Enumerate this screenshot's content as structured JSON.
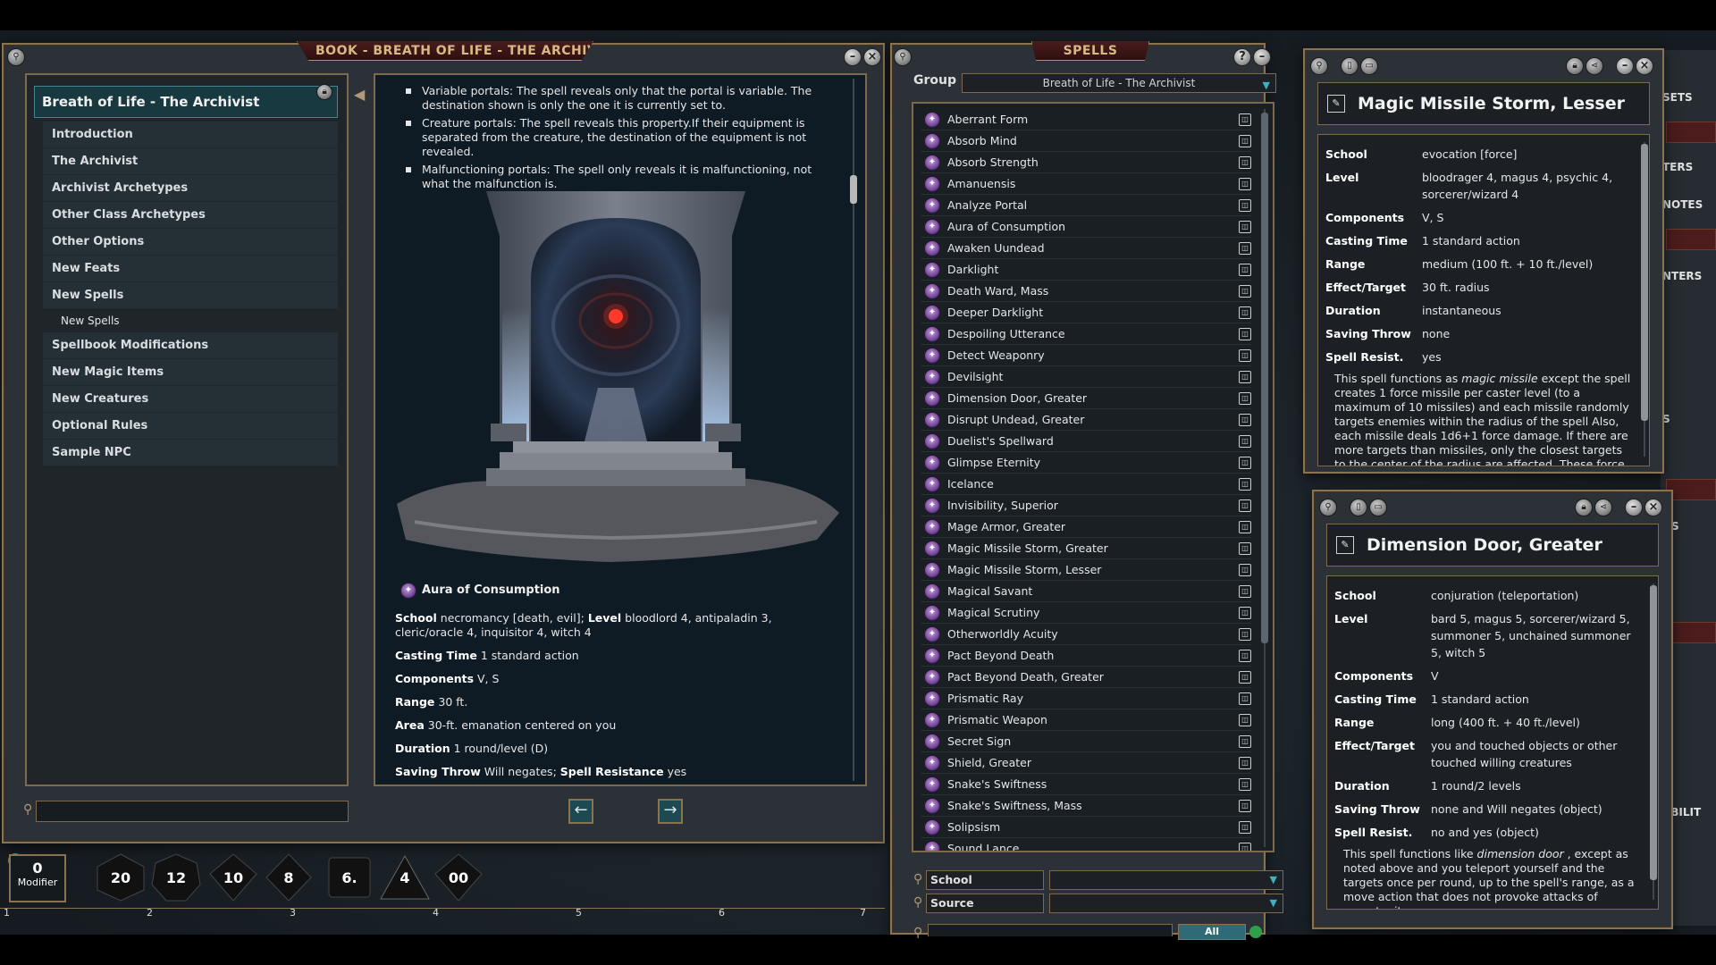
{
  "book": {
    "title": "BOOK - BREATH OF LIFE - THE ARCHIVIST",
    "toc_header": "Breath of Life - The Archivist",
    "toc": [
      "Introduction",
      "The Archivist",
      "Archivist Archetypes",
      "Other Class Archetypes",
      "Other Options",
      "New Feats",
      "New Spells"
    ],
    "toc_sub": "New Spells",
    "toc_after": [
      "Spellbook Modifications",
      "New Magic Items",
      "New Creatures",
      "Optional Rules",
      "Sample NPC"
    ],
    "bullets": [
      "Variable portals: The spell reveals only that the portal is variable. The destination shown is only the one it is currently set to.",
      "Creature portals: The spell reveals this property.If their equipment is separated from the creature, the destination of the equipment is not revealed.",
      "Malfunctioning portals: The spell only reveals it is malfunctioning, not what the malfunction is."
    ],
    "spell_name": "Aura of Consumption",
    "stats": {
      "school_label": "School",
      "school": "necromancy [death, evil];",
      "level_label": "Level",
      "level": "bloodlord 4, antipaladin 3, cleric/oracle 4, inquisitor 4, witch 4",
      "casting_label": "Casting Time",
      "casting": "1 standard action",
      "components_label": "Components",
      "components": "V, S",
      "range_label": "Range",
      "range": "30 ft.",
      "area_label": "Area",
      "area": "30-ft. emanation centered on you",
      "duration_label": "Duration",
      "duration": "1 round/level (D)",
      "save_label": "Saving Throw",
      "save": "Will negates;",
      "sr_label": "Spell Resistance",
      "sr": "yes"
    },
    "nav_prev": "←",
    "nav_next": "→"
  },
  "spells": {
    "title": "SPELLS",
    "group_label": "Group",
    "group_value": "Breath of Life - The Archivist",
    "list": [
      "Aberrant Form",
      "Absorb Mind",
      "Absorb Strength",
      "Amanuensis",
      "Analyze Portal",
      "Aura of Consumption",
      "Awaken Uundead",
      "Darklight",
      "Death Ward, Mass",
      "Deeper Darklight",
      "Despoiling Utterance",
      "Detect Weaponry",
      "Devilsight",
      "Dimension Door, Greater",
      "Disrupt Undead, Greater",
      "Duelist's Spellward",
      "Glimpse Eternity",
      "Icelance",
      "Invisibility, Superior",
      "Mage Armor, Greater",
      "Magic Missile Storm, Greater",
      "Magic Missile Storm, Lesser",
      "Magical Savant",
      "Magical Scrutiny",
      "Otherworldly Acuity",
      "Pact Beyond Death",
      "Pact Beyond Death, Greater",
      "Prismatic Ray",
      "Prismatic Weapon",
      "Secret Sign",
      "Shield, Greater",
      "Snake's Swiftness",
      "Snake's Swiftness, Mass",
      "Solipsism",
      "Sound Lance"
    ],
    "filter_school": "School",
    "filter_source": "Source",
    "all_button": "All"
  },
  "detail1": {
    "title": "Magic Missile Storm, Lesser",
    "fields": [
      {
        "k": "School",
        "v": "evocation [force]"
      },
      {
        "k": "Level",
        "v": "bloodrager 4, magus 4, psychic 4, sorcerer/wizard 4"
      },
      {
        "k": "Components",
        "v": "V, S"
      },
      {
        "k": "Casting Time",
        "v": "1 standard action"
      },
      {
        "k": "Range",
        "v": "medium (100 ft. + 10 ft./level)"
      },
      {
        "k": "Effect/Target",
        "v": "30 ft. radius"
      },
      {
        "k": "Duration",
        "v": "instantaneous"
      },
      {
        "k": "Saving Throw",
        "v": "none"
      },
      {
        "k": "Spell Resist.",
        "v": "yes"
      }
    ],
    "desc_pre": "This spell functions as ",
    "desc_em": "magic missile",
    "desc_post": " except the spell creates 1 force missile per caster level (to a maximum of 10 missiles) and each missile randomly targets enemies within the radius of the spell Also, each missile deals 1d6+1 force damage. If there are more targets than missiles, only the closest targets to the center of the radius are affected. These force missiles are"
  },
  "detail2": {
    "title": "Dimension Door, Greater",
    "fields": [
      {
        "k": "School",
        "v": "conjuration (teleportation)"
      },
      {
        "k": "Level",
        "v": "bard 5, magus 5, sorcerer/wizard 5, summoner 5, unchained summoner 5, witch 5"
      },
      {
        "k": "Components",
        "v": "V"
      },
      {
        "k": "Casting Time",
        "v": "1 standard action"
      },
      {
        "k": "Range",
        "v": "long (400 ft. + 40 ft./level)"
      },
      {
        "k": "Effect/Target",
        "v": "you and touched objects or other touched willing creatures"
      },
      {
        "k": "Duration",
        "v": "1 round/2 levels"
      },
      {
        "k": "Saving Throw",
        "v": "none and Will negates (object)"
      },
      {
        "k": "Spell Resist.",
        "v": "no and yes (object)"
      }
    ],
    "desc_pre": "This spell functions like ",
    "desc_em": "dimension door",
    "desc_post": " , except as noted above and you teleport yourself and the targets once per round, up to the spell's range, as a move action that does not provoke attacks of opportunity."
  },
  "hotbar": {
    "modifier_value": "0",
    "modifier_label": "Modifier",
    "dice": [
      "20",
      "12",
      "10",
      "8",
      "6.",
      "4",
      "00"
    ],
    "slots": [
      "1",
      "2",
      "3",
      "4",
      "5",
      "6",
      "7"
    ]
  },
  "sidepanel": {
    "tabs": [
      "SETS",
      "TERS",
      "NOTES",
      "NTERS",
      "S",
      "NS",
      "ABILIT"
    ]
  },
  "colors": {
    "accent_gold": "#8a7350",
    "teal": "#17393f",
    "spell_purple": "#6a3c8e",
    "title_red": "#4a1c1c"
  }
}
